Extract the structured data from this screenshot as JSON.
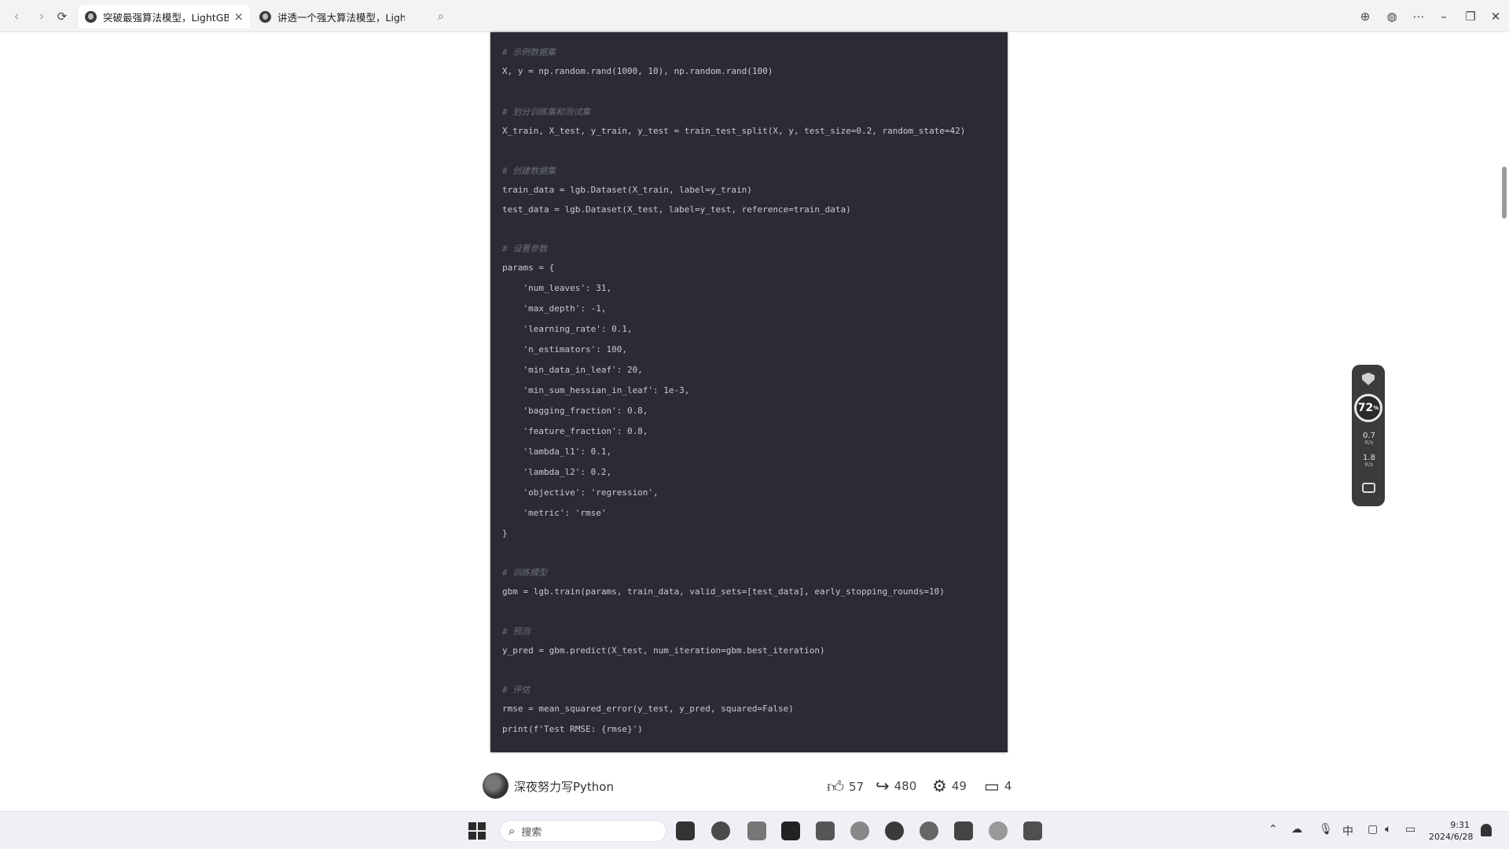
{
  "browser": {
    "tabs": [
      {
        "title": "突破最强算法模型，LightGBM",
        "active": true
      },
      {
        "title": "讲透一个强大算法模型，LightGBM",
        "active": false
      }
    ]
  },
  "code": {
    "lines": [
      {
        "text": "# 示例数据集",
        "type": "comment"
      },
      {
        "text": "X, y = np.random.rand(1000, 10), np.random.rand(100)",
        "type": "code"
      },
      {
        "text": "# 划分训练集和测试集",
        "type": "comment"
      },
      {
        "text": "X_train, X_test, y_train, y_test = train_test_split(X, y, test_size=0.2, random_state=42)",
        "type": "code"
      },
      {
        "text": "# 创建数据集",
        "type": "comment"
      },
      {
        "text": "train_data = lgb.Dataset(X_train, label=y_train)",
        "type": "code"
      },
      {
        "text": "test_data = lgb.Dataset(X_test, label=y_test, reference=train_data)",
        "type": "code"
      },
      {
        "text": "# 设置参数",
        "type": "comment"
      },
      {
        "text": "params = {",
        "type": "code"
      },
      {
        "text": "    'num_leaves': 31,",
        "type": "code"
      },
      {
        "text": "    'max_depth': -1,",
        "type": "code"
      },
      {
        "text": "    'learning_rate': 0.1,",
        "type": "code"
      },
      {
        "text": "    'n_estimators': 100,",
        "type": "code"
      },
      {
        "text": "    'min_data_in_leaf': 20,",
        "type": "code"
      },
      {
        "text": "    'min_sum_hessian_in_leaf': 1e-3,",
        "type": "code"
      },
      {
        "text": "    'bagging_fraction': 0.8,",
        "type": "code"
      },
      {
        "text": "    'feature_fraction': 0.8,",
        "type": "code"
      },
      {
        "text": "    'lambda_l1': 0.1,",
        "type": "code"
      },
      {
        "text": "    'lambda_l2': 0.2,",
        "type": "code"
      },
      {
        "text": "    'objective': 'regression',",
        "type": "code"
      },
      {
        "text": "    'metric': 'rmse'",
        "type": "code"
      },
      {
        "text": "}",
        "type": "code"
      },
      {
        "text": "# 训练模型",
        "type": "comment"
      },
      {
        "text": "gbm = lgb.train(params, train_data, valid_sets=[test_data], early_stopping_rounds=10)",
        "type": "code"
      },
      {
        "text": "# 预测",
        "type": "comment"
      },
      {
        "text": "y_pred = gbm.predict(X_test, num_iteration=gbm.best_iteration)",
        "type": "code"
      },
      {
        "text": "# 评估",
        "type": "comment"
      },
      {
        "text": "rmse = mean_squared_error(y_test, y_pred, squared=False)",
        "type": "code"
      },
      {
        "text": "print(f'Test RMSE: {rmse}')",
        "type": "code"
      }
    ]
  },
  "author": {
    "name": "深夜努力写Python"
  },
  "stats": {
    "likes": "57",
    "shares": "480",
    "favorites": "49",
    "comments": "4"
  },
  "widget": {
    "cpu": "72",
    "cpu_unit": "%",
    "upload": "0.7",
    "upload_unit": "K/s",
    "download": "1.8",
    "download_unit": "K/s"
  },
  "taskbar": {
    "search_placeholder": "搜索",
    "ime": "中",
    "time": "9:31",
    "date": "2024/6/28"
  },
  "icons": {
    "back": "back-arrow-icon",
    "forward": "forward-arrow-icon",
    "refresh": "refresh-icon",
    "search": "search-icon",
    "download": "download-icon",
    "globe": "globe-icon",
    "more": "more-icon",
    "like": "thumbs-up-icon",
    "share": "share-icon",
    "favorite": "gear-favorite-icon",
    "comment": "comment-icon"
  }
}
